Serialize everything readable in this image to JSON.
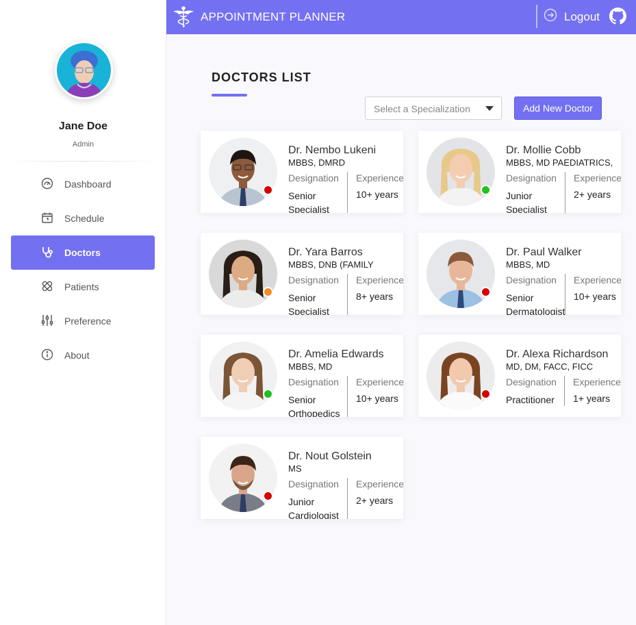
{
  "app": {
    "title": "APPOINTMENT PLANNER",
    "logout_label": "Logout"
  },
  "user": {
    "name": "Jane Doe",
    "role": "Admin"
  },
  "nav": [
    {
      "label": "Dashboard",
      "icon": "dashboard-gauge-icon",
      "active": false
    },
    {
      "label": "Schedule",
      "icon": "calendar-icon",
      "active": false
    },
    {
      "label": "Doctors",
      "icon": "stethoscope-icon",
      "active": true
    },
    {
      "label": "Patients",
      "icon": "bandage-icon",
      "active": false
    },
    {
      "label": "Preference",
      "icon": "sliders-icon",
      "active": false
    },
    {
      "label": "About",
      "icon": "info-icon",
      "active": false
    }
  ],
  "page": {
    "title": "DOCTORS LIST",
    "specialization_placeholder": "Select a Specialization",
    "add_button": "Add New Doctor"
  },
  "labels": {
    "designation": "Designation",
    "experience": "Experience"
  },
  "colors": {
    "accent": "#7370f2",
    "status_busy": "#d60000",
    "status_available": "#1ec21e",
    "status_away": "#f28c28"
  },
  "doctors": [
    {
      "name": "Dr. Nembo Lukeni",
      "qualification": "MBBS, DMRD",
      "designation": "Senior Specialist",
      "experience": "10+ years",
      "status": "busy"
    },
    {
      "name": "Dr. Mollie Cobb",
      "qualification": "MBBS, MD PAEDIATRICS,",
      "designation": "Junior Specialist",
      "experience": "2+ years",
      "status": "available"
    },
    {
      "name": "Dr. Yara Barros",
      "qualification": "MBBS, DNB (FAMILY",
      "designation": "Senior Specialist",
      "experience": "8+ years",
      "status": "away"
    },
    {
      "name": "Dr. Paul Walker",
      "qualification": "MBBS, MD",
      "designation": "Senior Dermatologist",
      "experience": "10+ years",
      "status": "busy"
    },
    {
      "name": "Dr. Amelia Edwards",
      "qualification": "MBBS, MD",
      "designation": "Senior Orthopedics",
      "experience": "10+ years",
      "status": "available"
    },
    {
      "name": "Dr. Alexa Richardson",
      "qualification": "MD, DM, FACC, FICC",
      "designation": "Practitioner",
      "experience": "1+ years",
      "status": "busy"
    },
    {
      "name": "Dr. Nout Golstein",
      "qualification": "MS",
      "designation": "Junior Cardiologist",
      "experience": "2+ years",
      "status": "busy"
    }
  ]
}
